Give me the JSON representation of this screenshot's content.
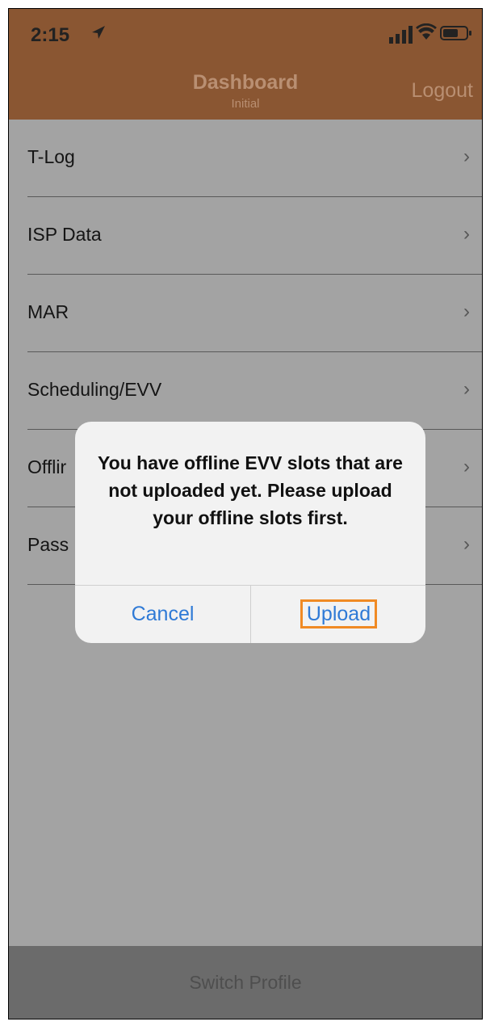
{
  "status_bar": {
    "time": "2:15",
    "location_icon": "location-arrow-icon",
    "signal_icon": "signal-icon",
    "wifi_icon": "wifi-icon",
    "battery_icon": "battery-icon"
  },
  "nav": {
    "title": "Dashboard",
    "subtitle": "Initial",
    "logout_label": "Logout"
  },
  "list": {
    "items": [
      {
        "label": "T-Log"
      },
      {
        "label": "ISP Data"
      },
      {
        "label": "MAR"
      },
      {
        "label": "Scheduling/EVV"
      },
      {
        "label": "Offlir"
      },
      {
        "label": "Pass"
      }
    ]
  },
  "alert": {
    "message": "You have offline EVV slots that are not uploaded yet. Please upload your offline slots first.",
    "cancel_label": "Cancel",
    "upload_label": "Upload"
  },
  "footer": {
    "switch_profile_label": "Switch Profile"
  },
  "colors": {
    "nav_background": "#8a5632",
    "alert_button": "#2f7ad6",
    "highlight_border": "#f08a24"
  }
}
